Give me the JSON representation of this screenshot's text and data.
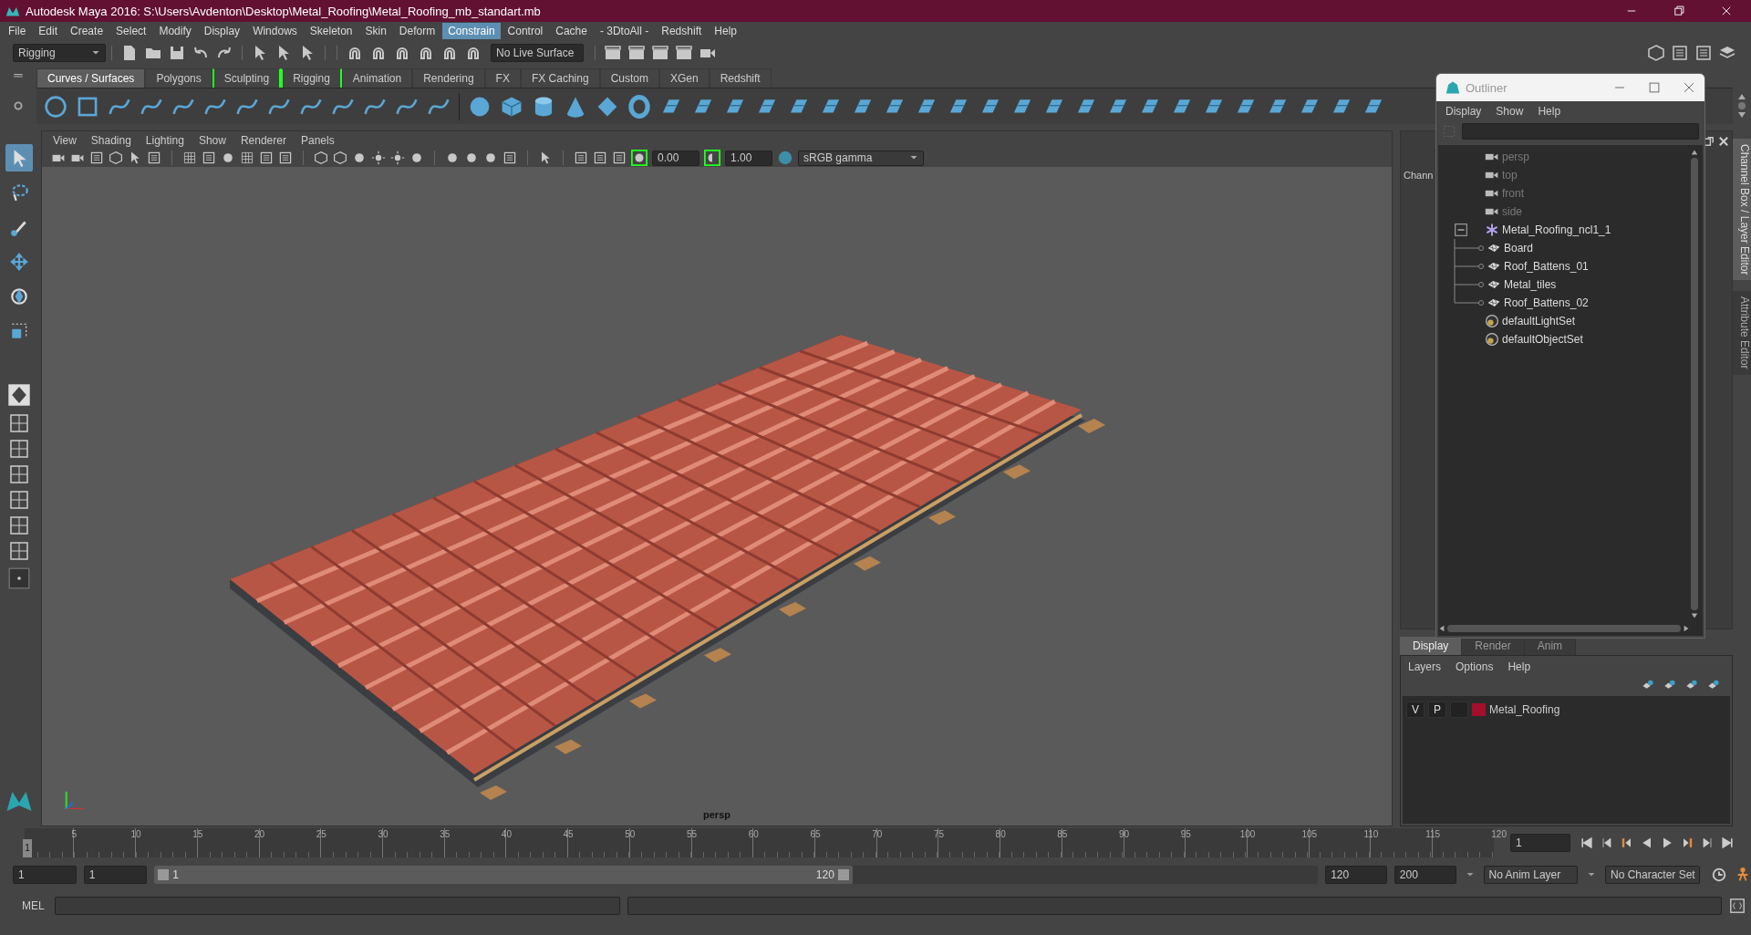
{
  "window": {
    "title": "Autodesk Maya 2016: S:\\Users\\Avdenton\\Desktop\\Metal_Roofing\\Metal_Roofing_mb_standart.mb"
  },
  "menu_bar": [
    {
      "label": "File",
      "selected": false
    },
    {
      "label": "Edit",
      "selected": false
    },
    {
      "label": "Create",
      "selected": false
    },
    {
      "label": "Select",
      "selected": false
    },
    {
      "label": "Modify",
      "selected": false
    },
    {
      "label": "Display",
      "selected": false
    },
    {
      "label": "Windows",
      "selected": false
    },
    {
      "label": "Skeleton",
      "selected": false
    },
    {
      "label": "Skin",
      "selected": false
    },
    {
      "label": "Deform",
      "selected": false
    },
    {
      "label": "Constrain",
      "selected": true
    },
    {
      "label": "Control",
      "selected": false
    },
    {
      "label": "Cache",
      "selected": false
    },
    {
      "label": "- 3DtoAll -",
      "selected": false
    },
    {
      "label": "Redshift",
      "selected": false
    },
    {
      "label": "Help",
      "selected": false
    }
  ],
  "toolbar": {
    "mode": "Rigging",
    "live_surface": "No Live Surface"
  },
  "shelf_tabs": [
    {
      "label": "Curves / Surfaces",
      "selected": true,
      "bracketed": false
    },
    {
      "label": "Polygons",
      "selected": false,
      "bracketed": false
    },
    {
      "label": "Sculpting",
      "selected": false,
      "bracketed": true
    },
    {
      "label": "Rigging",
      "selected": false,
      "bracketed": true
    },
    {
      "label": "Animation",
      "selected": false,
      "bracketed": false
    },
    {
      "label": "Rendering",
      "selected": false,
      "bracketed": false
    },
    {
      "label": "FX",
      "selected": false,
      "bracketed": false
    },
    {
      "label": "FX Caching",
      "selected": false,
      "bracketed": false
    },
    {
      "label": "Custom",
      "selected": false,
      "bracketed": false
    },
    {
      "label": "XGen",
      "selected": false,
      "bracketed": false
    },
    {
      "label": "Redshift",
      "selected": false,
      "bracketed": false
    }
  ],
  "tools": [
    {
      "kind": "select",
      "selected": true
    },
    {
      "kind": "lasso",
      "selected": false
    },
    {
      "kind": "paint",
      "selected": false
    },
    {
      "kind": "move",
      "selected": false
    },
    {
      "kind": "rotate",
      "selected": false
    },
    {
      "kind": "scale",
      "selected": false
    }
  ],
  "viewport": {
    "menus": [
      "View",
      "Shading",
      "Lighting",
      "Show",
      "Renderer",
      "Panels"
    ],
    "exposure": "0.00",
    "gamma": "1.00",
    "color_space": "sRGB gamma",
    "camera_label": "persp"
  },
  "channel_box": {
    "title": "Chann"
  },
  "outliner": {
    "title": "Outliner",
    "menus": [
      "Display",
      "Show",
      "Help"
    ],
    "items": [
      {
        "label": "persp",
        "kind": "camera",
        "dimmed": true
      },
      {
        "label": "top",
        "kind": "camera",
        "dimmed": true
      },
      {
        "label": "front",
        "kind": "camera",
        "dimmed": true
      },
      {
        "label": "side",
        "kind": "camera",
        "dimmed": true
      },
      {
        "label": "Metal_Roofing_ncl1_1",
        "kind": "group",
        "dimmed": false,
        "expanded": true,
        "children": [
          {
            "label": "Board",
            "kind": "mesh",
            "dimmed": false
          },
          {
            "label": "Roof_Battens_01",
            "kind": "mesh",
            "dimmed": false
          },
          {
            "label": "Metal_tiles",
            "kind": "mesh",
            "dimmed": false
          },
          {
            "label": "Roof_Battens_02",
            "kind": "mesh",
            "dimmed": false
          }
        ]
      },
      {
        "label": "defaultLightSet",
        "kind": "set",
        "dimmed": false
      },
      {
        "label": "defaultObjectSet",
        "kind": "set",
        "dimmed": false
      }
    ]
  },
  "side_tabs": [
    {
      "label": "Channel Box / Layer Editor",
      "selected": true
    },
    {
      "label": "Attribute Editor",
      "selected": false
    }
  ],
  "layer_editor": {
    "tabs": [
      {
        "label": "Display",
        "selected": true
      },
      {
        "label": "Render",
        "selected": false
      },
      {
        "label": "Anim",
        "selected": false
      }
    ],
    "menus": [
      "Layers",
      "Options",
      "Help"
    ],
    "layers": [
      {
        "visibility": "V",
        "playback": "P",
        "name": "Metal_Roofing",
        "color": "#a50e2d"
      }
    ]
  },
  "timeline": {
    "current_frame": "1",
    "frame_field": "1",
    "ticks": [
      "5",
      "10",
      "15",
      "20",
      "25",
      "30",
      "35",
      "40",
      "45",
      "50",
      "55",
      "60",
      "65",
      "70",
      "75",
      "80",
      "85",
      "90",
      "95",
      "100",
      "105",
      "110",
      "115",
      "120"
    ]
  },
  "range": {
    "start": "1",
    "playback_start": "1",
    "slider_start": "1",
    "slider_end": "120",
    "level": 0.6,
    "playback_end": "120",
    "end": "200",
    "anim_layer": "No Anim Layer",
    "character_set": "No Character Set"
  },
  "command_line": {
    "label": "MEL"
  }
}
